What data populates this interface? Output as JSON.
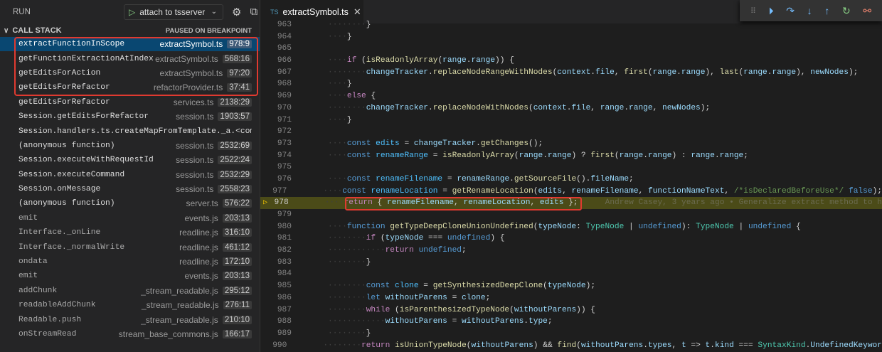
{
  "run": {
    "title": "RUN",
    "config": "attach to tsserver"
  },
  "callstack": {
    "title": "CALL STACK",
    "status": "PAUSED ON BREAKPOINT",
    "frames": [
      {
        "fn": "extractFunctionInScope",
        "file": "extractSymbol.ts",
        "loc": "978:9"
      },
      {
        "fn": "getFunctionExtractionAtIndex",
        "file": "extractSymbol.ts",
        "loc": "568:16"
      },
      {
        "fn": "getEditsForAction",
        "file": "extractSymbol.ts",
        "loc": "97:20"
      },
      {
        "fn": "getEditsForRefactor",
        "file": "refactorProvider.ts",
        "loc": "37:41"
      },
      {
        "fn": "getEditsForRefactor",
        "file": "services.ts",
        "loc": "2138:29"
      },
      {
        "fn": "Session.getEditsForRefactor",
        "file": "session.ts",
        "loc": "1903:57"
      },
      {
        "fn": "Session.handlers.ts.createMapFromTemplate._a.<computed>",
        "file": "",
        "loc": ""
      },
      {
        "fn": "(anonymous function)",
        "file": "session.ts",
        "loc": "2532:69"
      },
      {
        "fn": "Session.executeWithRequestId",
        "file": "session.ts",
        "loc": "2522:24"
      },
      {
        "fn": "Session.executeCommand",
        "file": "session.ts",
        "loc": "2532:29"
      },
      {
        "fn": "Session.onMessage",
        "file": "session.ts",
        "loc": "2558:23"
      },
      {
        "fn": "(anonymous function)",
        "file": "server.ts",
        "loc": "576:22"
      },
      {
        "fn": "emit",
        "file": "events.js",
        "loc": "203:13"
      },
      {
        "fn": "Interface._onLine",
        "file": "readline.js",
        "loc": "316:10"
      },
      {
        "fn": "Interface._normalWrite",
        "file": "readline.js",
        "loc": "461:12"
      },
      {
        "fn": "ondata",
        "file": "readline.js",
        "loc": "172:10"
      },
      {
        "fn": "emit",
        "file": "events.js",
        "loc": "203:13"
      },
      {
        "fn": "addChunk",
        "file": "_stream_readable.js",
        "loc": "295:12"
      },
      {
        "fn": "readableAddChunk",
        "file": "_stream_readable.js",
        "loc": "276:11"
      },
      {
        "fn": "Readable.push",
        "file": "_stream_readable.js",
        "loc": "210:10"
      },
      {
        "fn": "onStreamRead",
        "file": "stream_base_commons.js",
        "loc": "166:17"
      }
    ]
  },
  "tab": {
    "badge": "TS",
    "name": "extractSymbol.ts"
  },
  "editor": {
    "current_line": 978,
    "blame": "Andrew Casey, 3 years ago • Generalize extract method to h",
    "lines": [
      {
        "n": 963,
        "t": [
          [
            "p",
            "        }"
          ]
        ]
      },
      {
        "n": 964,
        "t": [
          [
            "p",
            "    }"
          ]
        ]
      },
      {
        "n": 965,
        "t": []
      },
      {
        "n": 966,
        "t": [
          [
            "p",
            "    "
          ],
          [
            "c",
            "if"
          ],
          [
            "p",
            " ("
          ],
          [
            "f",
            "isReadonlyArray"
          ],
          [
            "p",
            "("
          ],
          [
            "v",
            "range"
          ],
          [
            "p",
            "."
          ],
          [
            "v",
            "range"
          ],
          [
            "p",
            ")) {"
          ]
        ]
      },
      {
        "n": 967,
        "t": [
          [
            "p",
            "        "
          ],
          [
            "v",
            "changeTracker"
          ],
          [
            "p",
            "."
          ],
          [
            "f",
            "replaceNodeRangeWithNodes"
          ],
          [
            "p",
            "("
          ],
          [
            "v",
            "context"
          ],
          [
            "p",
            "."
          ],
          [
            "v",
            "file"
          ],
          [
            "p",
            ", "
          ],
          [
            "f",
            "first"
          ],
          [
            "p",
            "("
          ],
          [
            "v",
            "range"
          ],
          [
            "p",
            "."
          ],
          [
            "v",
            "range"
          ],
          [
            "p",
            "), "
          ],
          [
            "f",
            "last"
          ],
          [
            "p",
            "("
          ],
          [
            "v",
            "range"
          ],
          [
            "p",
            "."
          ],
          [
            "v",
            "range"
          ],
          [
            "p",
            "), "
          ],
          [
            "v",
            "newNodes"
          ],
          [
            "p",
            ");"
          ]
        ]
      },
      {
        "n": 968,
        "t": [
          [
            "p",
            "    }"
          ]
        ]
      },
      {
        "n": 969,
        "t": [
          [
            "p",
            "    "
          ],
          [
            "c",
            "else"
          ],
          [
            "p",
            " {"
          ]
        ]
      },
      {
        "n": 970,
        "t": [
          [
            "p",
            "        "
          ],
          [
            "v",
            "changeTracker"
          ],
          [
            "p",
            "."
          ],
          [
            "f",
            "replaceNodeWithNodes"
          ],
          [
            "p",
            "("
          ],
          [
            "v",
            "context"
          ],
          [
            "p",
            "."
          ],
          [
            "v",
            "file"
          ],
          [
            "p",
            ", "
          ],
          [
            "v",
            "range"
          ],
          [
            "p",
            "."
          ],
          [
            "v",
            "range"
          ],
          [
            "p",
            ", "
          ],
          [
            "v",
            "newNodes"
          ],
          [
            "p",
            ");"
          ]
        ]
      },
      {
        "n": 971,
        "t": [
          [
            "p",
            "    }"
          ]
        ]
      },
      {
        "n": 972,
        "t": []
      },
      {
        "n": 973,
        "t": [
          [
            "p",
            "    "
          ],
          [
            "k",
            "const"
          ],
          [
            "p",
            " "
          ],
          [
            "e",
            "edits"
          ],
          [
            "p",
            " = "
          ],
          [
            "v",
            "changeTracker"
          ],
          [
            "p",
            "."
          ],
          [
            "f",
            "getChanges"
          ],
          [
            "p",
            "();"
          ]
        ]
      },
      {
        "n": 974,
        "t": [
          [
            "p",
            "    "
          ],
          [
            "k",
            "const"
          ],
          [
            "p",
            " "
          ],
          [
            "e",
            "renameRange"
          ],
          [
            "p",
            " = "
          ],
          [
            "f",
            "isReadonlyArray"
          ],
          [
            "p",
            "("
          ],
          [
            "v",
            "range"
          ],
          [
            "p",
            "."
          ],
          [
            "v",
            "range"
          ],
          [
            "p",
            ") ? "
          ],
          [
            "f",
            "first"
          ],
          [
            "p",
            "("
          ],
          [
            "v",
            "range"
          ],
          [
            "p",
            "."
          ],
          [
            "v",
            "range"
          ],
          [
            "p",
            ") : "
          ],
          [
            "v",
            "range"
          ],
          [
            "p",
            "."
          ],
          [
            "v",
            "range"
          ],
          [
            "p",
            ";"
          ]
        ]
      },
      {
        "n": 975,
        "t": []
      },
      {
        "n": 976,
        "t": [
          [
            "p",
            "    "
          ],
          [
            "k",
            "const"
          ],
          [
            "p",
            " "
          ],
          [
            "e",
            "renameFilename"
          ],
          [
            "p",
            " = "
          ],
          [
            "v",
            "renameRange"
          ],
          [
            "p",
            "."
          ],
          [
            "f",
            "getSourceFile"
          ],
          [
            "p",
            "()."
          ],
          [
            "v",
            "fileName"
          ],
          [
            "p",
            ";"
          ]
        ]
      },
      {
        "n": 977,
        "t": [
          [
            "p",
            "    "
          ],
          [
            "k",
            "const"
          ],
          [
            "p",
            " "
          ],
          [
            "e",
            "renameLocation"
          ],
          [
            "p",
            " = "
          ],
          [
            "f",
            "getRenameLocation"
          ],
          [
            "p",
            "("
          ],
          [
            "v",
            "edits"
          ],
          [
            "p",
            ", "
          ],
          [
            "v",
            "renameFilename"
          ],
          [
            "p",
            ", "
          ],
          [
            "v",
            "functionNameText"
          ],
          [
            "p",
            ", "
          ],
          [
            "m",
            "/*isDeclaredBeforeUse*/"
          ],
          [
            "p",
            " "
          ],
          [
            "k",
            "false"
          ],
          [
            "p",
            ");"
          ]
        ]
      },
      {
        "n": 978,
        "t": [
          [
            "p",
            "    "
          ],
          [
            "c",
            "return"
          ],
          [
            "p",
            " { "
          ],
          [
            "v",
            "renameFilename"
          ],
          [
            "p",
            ", "
          ],
          [
            "v",
            "renameLocation"
          ],
          [
            "p",
            ", "
          ],
          [
            "v",
            "edits"
          ],
          [
            "p",
            " };"
          ]
        ]
      },
      {
        "n": 979,
        "t": []
      },
      {
        "n": 980,
        "t": [
          [
            "p",
            "    "
          ],
          [
            "k",
            "function"
          ],
          [
            "p",
            " "
          ],
          [
            "f",
            "getTypeDeepCloneUnionUndefined"
          ],
          [
            "p",
            "("
          ],
          [
            "v",
            "typeNode"
          ],
          [
            "p",
            ": "
          ],
          [
            "t",
            "TypeNode"
          ],
          [
            "p",
            " | "
          ],
          [
            "k",
            "undefined"
          ],
          [
            "p",
            "): "
          ],
          [
            "t",
            "TypeNode"
          ],
          [
            "p",
            " | "
          ],
          [
            "k",
            "undefined"
          ],
          [
            "p",
            " {"
          ]
        ]
      },
      {
        "n": 981,
        "t": [
          [
            "p",
            "        "
          ],
          [
            "c",
            "if"
          ],
          [
            "p",
            " ("
          ],
          [
            "v",
            "typeNode"
          ],
          [
            "p",
            " === "
          ],
          [
            "k",
            "undefined"
          ],
          [
            "p",
            ") {"
          ]
        ]
      },
      {
        "n": 982,
        "t": [
          [
            "p",
            "            "
          ],
          [
            "c",
            "return"
          ],
          [
            "p",
            " "
          ],
          [
            "k",
            "undefined"
          ],
          [
            "p",
            ";"
          ]
        ]
      },
      {
        "n": 983,
        "t": [
          [
            "p",
            "        }"
          ]
        ]
      },
      {
        "n": 984,
        "t": []
      },
      {
        "n": 985,
        "t": [
          [
            "p",
            "        "
          ],
          [
            "k",
            "const"
          ],
          [
            "p",
            " "
          ],
          [
            "e",
            "clone"
          ],
          [
            "p",
            " = "
          ],
          [
            "f",
            "getSynthesizedDeepClone"
          ],
          [
            "p",
            "("
          ],
          [
            "v",
            "typeNode"
          ],
          [
            "p",
            ");"
          ]
        ]
      },
      {
        "n": 986,
        "t": [
          [
            "p",
            "        "
          ],
          [
            "k",
            "let"
          ],
          [
            "p",
            " "
          ],
          [
            "v",
            "withoutParens"
          ],
          [
            "p",
            " = "
          ],
          [
            "v",
            "clone"
          ],
          [
            "p",
            ";"
          ]
        ]
      },
      {
        "n": 987,
        "t": [
          [
            "p",
            "        "
          ],
          [
            "c",
            "while"
          ],
          [
            "p",
            " ("
          ],
          [
            "f",
            "isParenthesizedTypeNode"
          ],
          [
            "p",
            "("
          ],
          [
            "v",
            "withoutParens"
          ],
          [
            "p",
            ")) {"
          ]
        ]
      },
      {
        "n": 988,
        "t": [
          [
            "p",
            "            "
          ],
          [
            "v",
            "withoutParens"
          ],
          [
            "p",
            " = "
          ],
          [
            "v",
            "withoutParens"
          ],
          [
            "p",
            "."
          ],
          [
            "v",
            "type"
          ],
          [
            "p",
            ";"
          ]
        ]
      },
      {
        "n": 989,
        "t": [
          [
            "p",
            "        }"
          ]
        ]
      },
      {
        "n": 990,
        "t": [
          [
            "p",
            "        "
          ],
          [
            "c",
            "return"
          ],
          [
            "p",
            " "
          ],
          [
            "f",
            "isUnionTypeNode"
          ],
          [
            "p",
            "("
          ],
          [
            "v",
            "withoutParens"
          ],
          [
            "p",
            ") && "
          ],
          [
            "f",
            "find"
          ],
          [
            "p",
            "("
          ],
          [
            "v",
            "withoutParens"
          ],
          [
            "p",
            "."
          ],
          [
            "v",
            "types"
          ],
          [
            "p",
            ", "
          ],
          [
            "v",
            "t"
          ],
          [
            "p",
            " => "
          ],
          [
            "v",
            "t"
          ],
          [
            "p",
            "."
          ],
          [
            "v",
            "kind"
          ],
          [
            "p",
            " === "
          ],
          [
            "t",
            "SyntaxKind"
          ],
          [
            "p",
            "."
          ],
          [
            "v",
            "UndefinedKeywor"
          ]
        ]
      }
    ]
  }
}
